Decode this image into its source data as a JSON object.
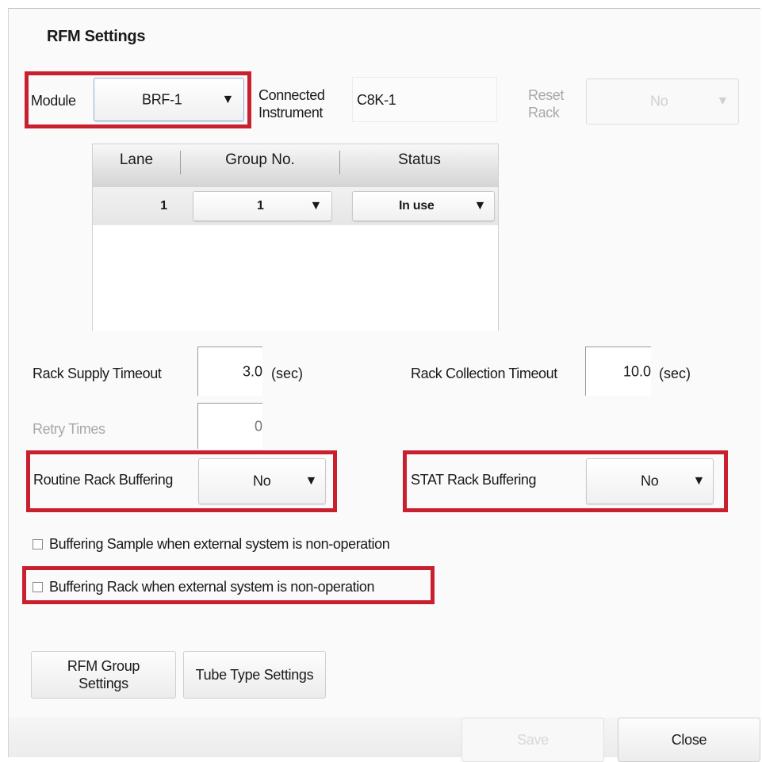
{
  "dialog": {
    "title": "RFM Settings"
  },
  "module": {
    "label": "Module",
    "value": "BRF-1"
  },
  "connected_instrument": {
    "label_line1": "Connected",
    "label_line2": "Instrument",
    "value": "C8K-1"
  },
  "reset_rack": {
    "label_line1": "Reset",
    "label_line2": "Rack",
    "value": "No"
  },
  "lane_table": {
    "columns": [
      "Lane",
      "Group No.",
      "Status"
    ],
    "rows": [
      {
        "lane": "1",
        "group": "1",
        "status": "In use"
      }
    ]
  },
  "rack_supply_timeout": {
    "label": "Rack Supply Timeout",
    "value": "3.0",
    "unit": "(sec)"
  },
  "rack_collection_timeout": {
    "label": "Rack Collection Timeout",
    "value": "10.0",
    "unit": "(sec)"
  },
  "retry_times": {
    "label": "Retry Times",
    "value": "0"
  },
  "routine_rack_buffering": {
    "label": "Routine Rack Buffering",
    "value": "No"
  },
  "stat_rack_buffering": {
    "label": "STAT Rack Buffering",
    "value": "No"
  },
  "checkboxes": {
    "buffering_sample": {
      "label": "Buffering Sample when external system is non-operation",
      "checked": false
    },
    "buffering_rack": {
      "label": "Buffering Rack when external system is non-operation",
      "checked": false
    }
  },
  "buttons": {
    "rfm_group_line1": "RFM Group",
    "rfm_group_line2": "Settings",
    "tube_type": "Tube Type Settings",
    "save": "Save",
    "close": "Close"
  },
  "icons": {
    "dropdown_arrow": "▼"
  },
  "colors": {
    "highlight": "#c8202f"
  }
}
